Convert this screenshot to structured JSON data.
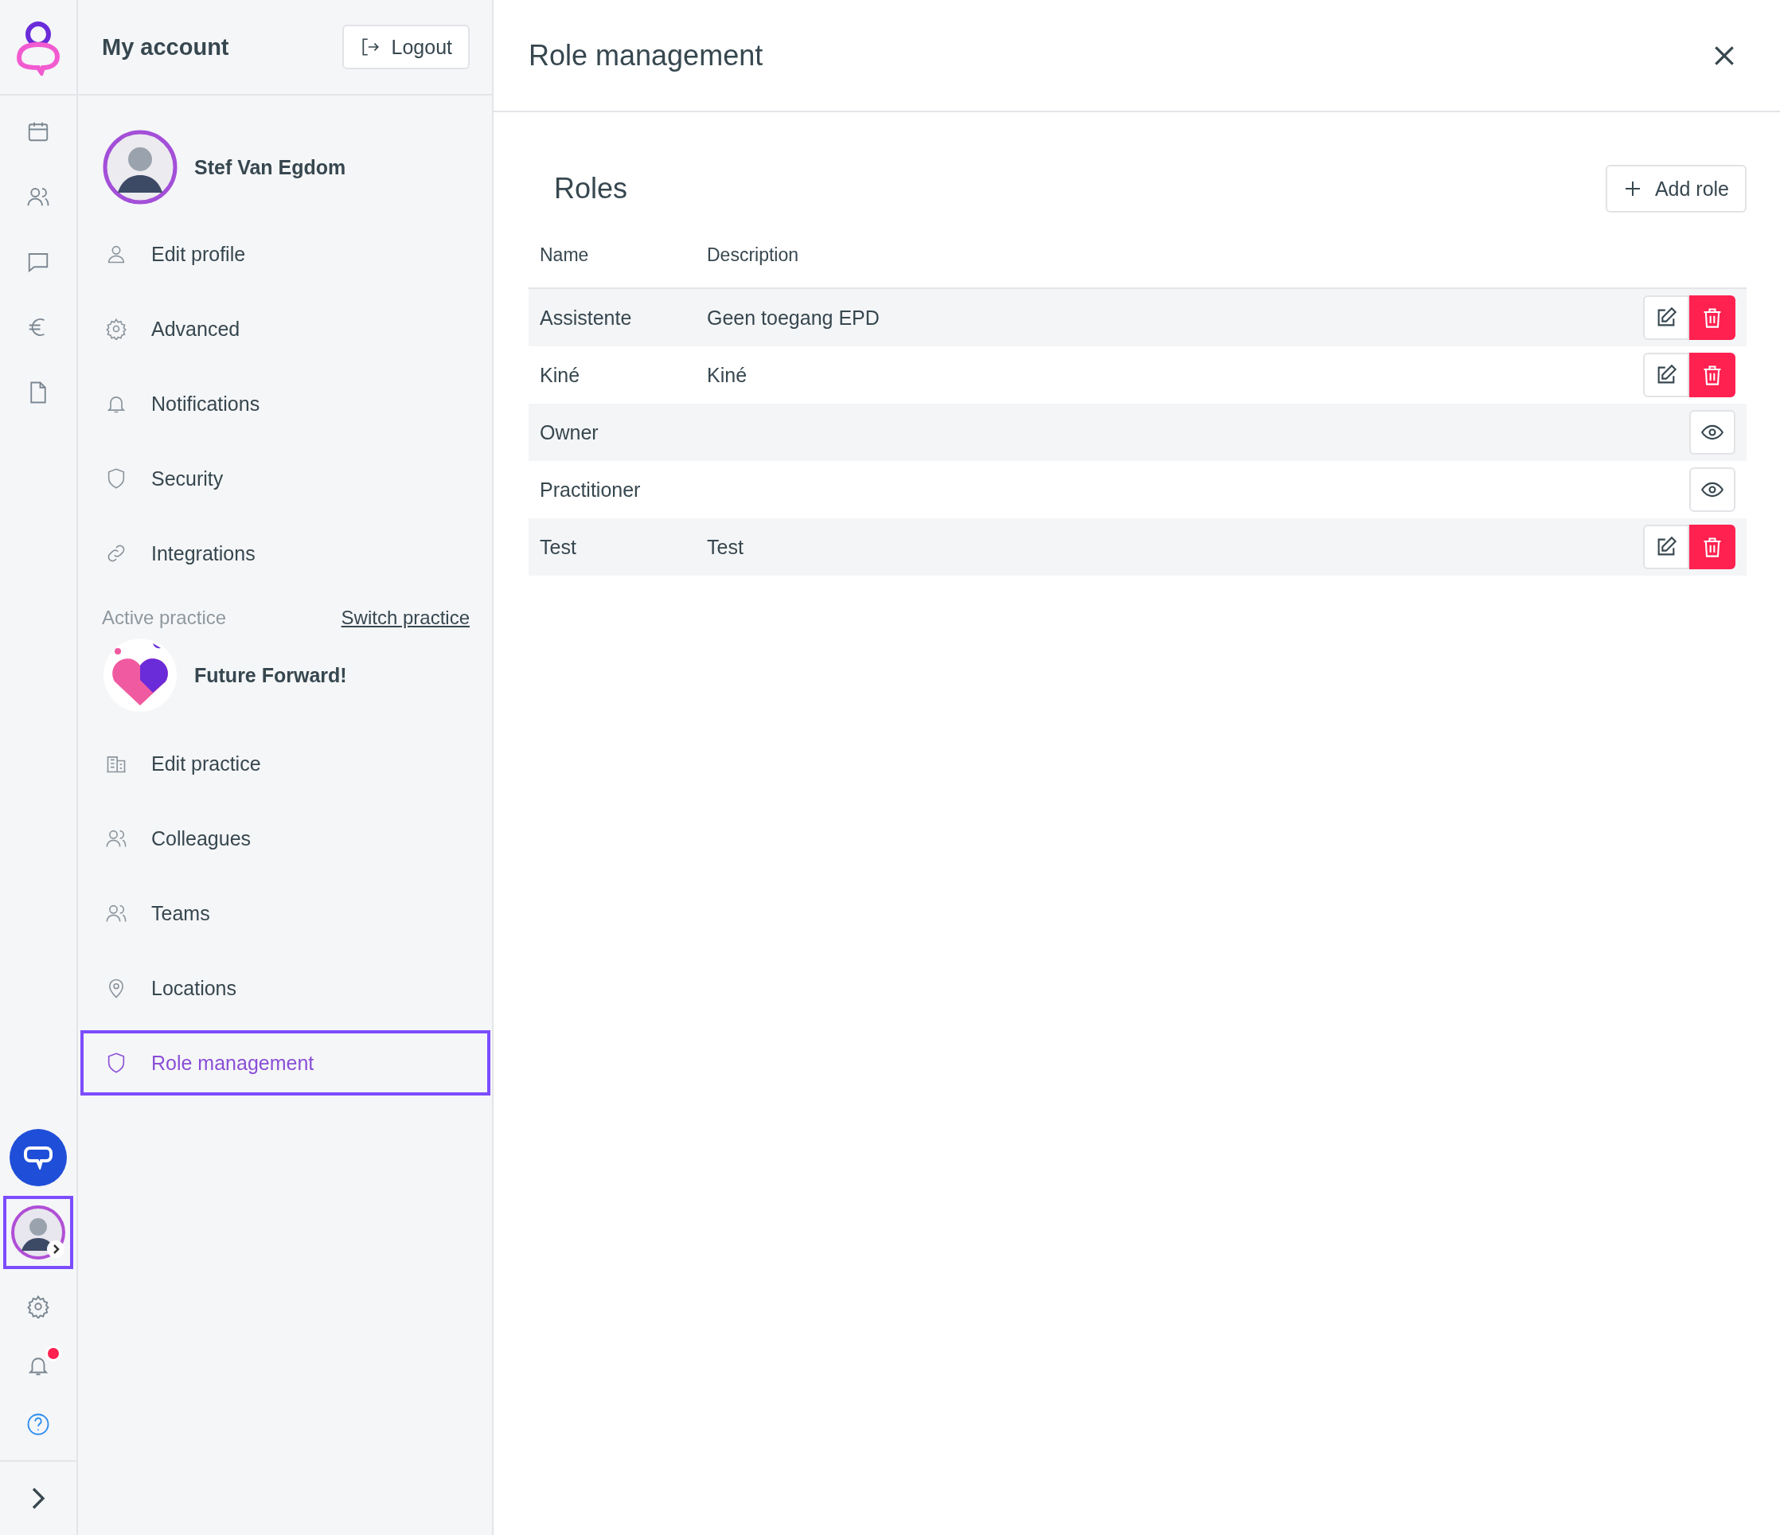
{
  "rail": {
    "account_selected": true,
    "notifications_unread": true
  },
  "account": {
    "title": "My account",
    "logout": "Logout",
    "user_name": "Stef Van Egdom",
    "profile_items": [
      {
        "label": "Edit profile",
        "kind": "person",
        "selected": false
      },
      {
        "label": "Advanced",
        "kind": "gear",
        "selected": false
      },
      {
        "label": "Notifications",
        "kind": "bell",
        "selected": false
      },
      {
        "label": "Security",
        "kind": "shield",
        "selected": false
      },
      {
        "label": "Integrations",
        "kind": "link",
        "selected": false
      }
    ],
    "active_practice_label": "Active practice",
    "switch_practice": "Switch practice",
    "practice_name": "Future Forward!",
    "practice_items": [
      {
        "label": "Edit practice",
        "kind": "building",
        "selected": false
      },
      {
        "label": "Colleagues",
        "kind": "people",
        "selected": false
      },
      {
        "label": "Teams",
        "kind": "people",
        "selected": false
      },
      {
        "label": "Locations",
        "kind": "pin",
        "selected": false
      },
      {
        "label": "Role management",
        "kind": "shield",
        "selected": true
      }
    ]
  },
  "panel": {
    "title": "Role management",
    "section_title": "Roles",
    "add_button": "Add role",
    "table": {
      "columns": [
        "Name",
        "Description"
      ],
      "rows": [
        {
          "name": "Assistente",
          "description": "Geen toegang EPD",
          "kind": "editable"
        },
        {
          "name": "Kiné",
          "description": "Kiné",
          "kind": "editable"
        },
        {
          "name": "Owner",
          "kind": "view"
        },
        {
          "name": "Practitioner",
          "kind": "view"
        },
        {
          "name": "Test",
          "description": "Test",
          "kind": "editable"
        }
      ]
    }
  }
}
